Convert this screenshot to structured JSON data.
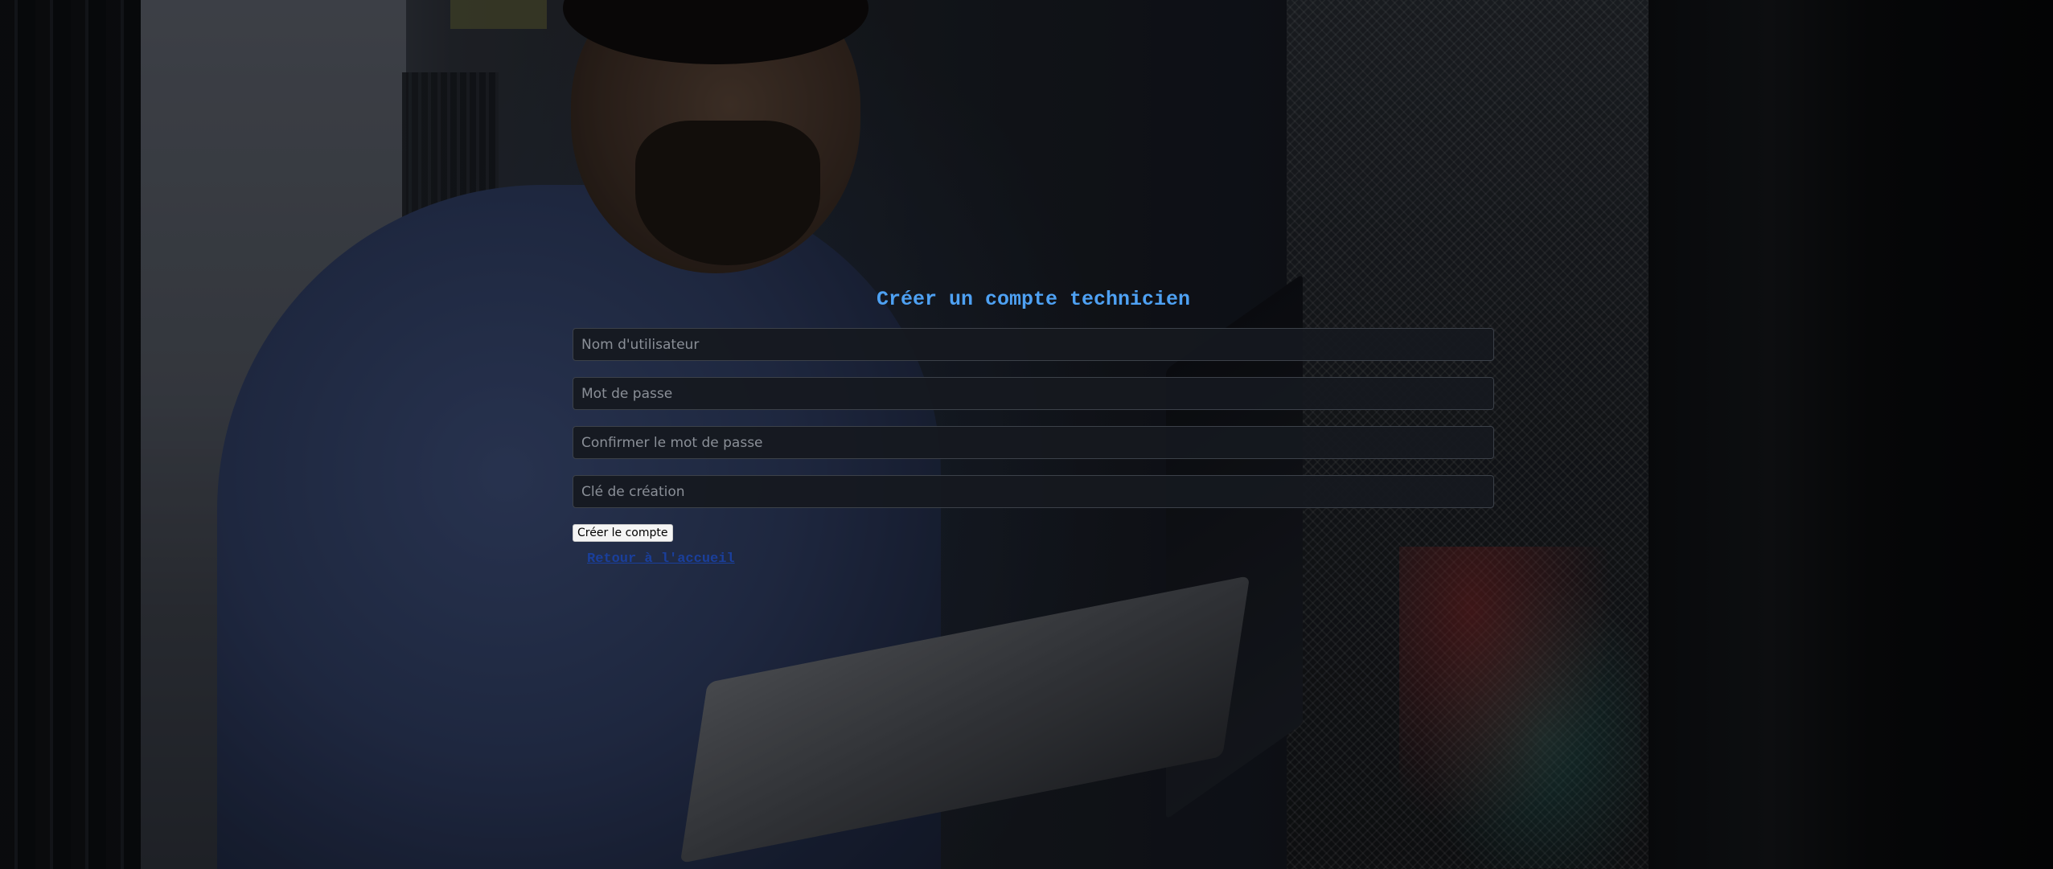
{
  "form": {
    "title": "Créer un compte technicien",
    "fields": [
      {
        "name": "username",
        "placeholder": "Nom d'utilisateur",
        "value": ""
      },
      {
        "name": "password",
        "placeholder": "Mot de passe",
        "value": ""
      },
      {
        "name": "confirm_password",
        "placeholder": "Confirmer le mot de passe",
        "value": ""
      },
      {
        "name": "creation_key",
        "placeholder": "Clé de création",
        "value": ""
      }
    ],
    "submit_label": "Créer le compte",
    "back_link_label": "Retour à l'accueil"
  },
  "colors": {
    "title": "#4ea1f3",
    "link": "#1a3f9c",
    "input_background": "#16191f"
  }
}
